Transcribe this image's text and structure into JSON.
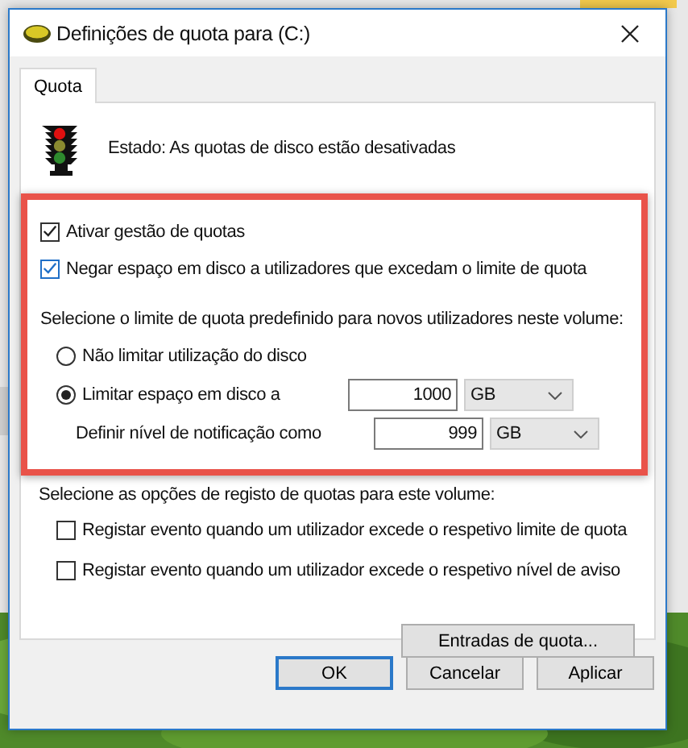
{
  "window": {
    "title": "Definições de quota para  (C:)"
  },
  "tabs": [
    {
      "label": "Quota",
      "selected": true
    }
  ],
  "status": {
    "text": "Estado: As quotas de disco estão desativadas"
  },
  "options": [
    {
      "label": "Ativar gestão de quotas",
      "checked": true
    },
    {
      "label": "Negar espaço em disco a utilizadores que excedam o limite de quota",
      "checked": true
    }
  ],
  "limit_prompt": "Selecione o limite de quota predefinido para novos utilizadores neste volume:",
  "limits": [
    {
      "label": "Não limitar utilização do disco",
      "selected": false
    },
    {
      "label": "Limitar espaço em disco a",
      "selected": true,
      "value": "1000",
      "unit": "GB"
    }
  ],
  "notification": {
    "label": "Definir nível de notificação como",
    "value": "999",
    "unit": "GB"
  },
  "logging": {
    "prompt": "Selecione as opções de registo de quotas para este volume:",
    "options": [
      {
        "label": "Registar evento quando um utilizador excede o respetivo limite de quota",
        "checked": false
      },
      {
        "label": "Registar evento quando um utilizador excede o respetivo nível de aviso",
        "checked": false
      }
    ]
  },
  "entries_button": "Entradas de quota...",
  "buttons": [
    {
      "label": "OK",
      "default": true
    },
    {
      "label": "Cancelar",
      "default": false
    },
    {
      "label": "Aplicar",
      "default": false
    }
  ]
}
